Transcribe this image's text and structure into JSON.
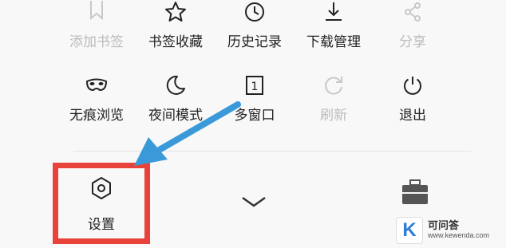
{
  "menu": {
    "row1": [
      {
        "label": "添加书签",
        "icon": "bookmark-add-icon",
        "disabled": true
      },
      {
        "label": "书签收藏",
        "icon": "star-icon",
        "disabled": false
      },
      {
        "label": "历史记录",
        "icon": "clock-icon",
        "disabled": false
      },
      {
        "label": "下载管理",
        "icon": "download-icon",
        "disabled": false
      },
      {
        "label": "分享",
        "icon": "share-icon",
        "disabled": true
      }
    ],
    "row2": [
      {
        "label": "无痕浏览",
        "icon": "mask-icon",
        "disabled": false
      },
      {
        "label": "夜间模式",
        "icon": "moon-icon",
        "disabled": false
      },
      {
        "label": "多窗口",
        "icon": "window-count-icon",
        "badge": "1",
        "disabled": false
      },
      {
        "label": "刷新",
        "icon": "refresh-icon",
        "disabled": true
      },
      {
        "label": "退出",
        "icon": "power-icon",
        "disabled": false
      }
    ]
  },
  "bottom_bar": {
    "settings_label": "设置",
    "settings_icon": "hexagon-settings-icon",
    "collapse_icon": "chevron-down-icon",
    "toolbox_icon": "toolbox-icon"
  },
  "watermark": {
    "logo_letter": "K",
    "title": "可问答",
    "url": "www.kewenda.com"
  },
  "colors": {
    "highlight_box": "#e8423a",
    "arrow": "#3a9ad9",
    "disabled_text": "#bbbbbb"
  }
}
